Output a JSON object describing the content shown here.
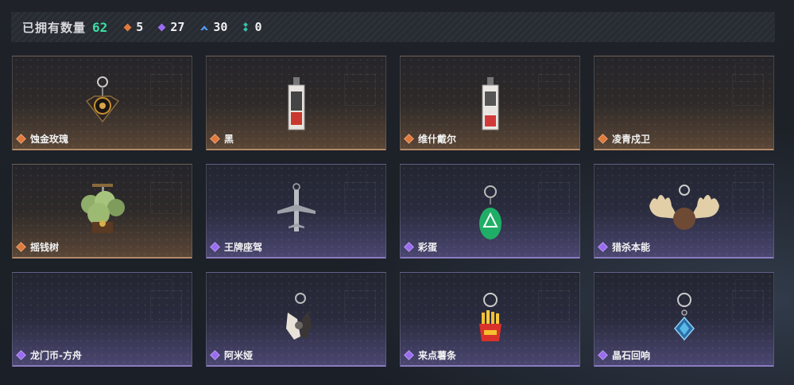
{
  "header": {
    "title": "已拥有数量",
    "count": "62",
    "stats": [
      {
        "icon": "orange-diamond-icon",
        "color": "#e07a3c",
        "value": "5"
      },
      {
        "icon": "purple-diamond-icon",
        "color": "#9a6cf0",
        "value": "27"
      },
      {
        "icon": "blue-chevron-icon",
        "color": "#4f9cf0",
        "value": "30"
      },
      {
        "icon": "teal-dots-icon",
        "color": "#32c4b0",
        "value": "0"
      }
    ]
  },
  "cards": [
    {
      "name": "蚀金玫瑰",
      "rarity": "orange",
      "item": "rose-charm"
    },
    {
      "name": "黑",
      "rarity": "orange",
      "item": "tag-charm"
    },
    {
      "name": "维什戴尔",
      "rarity": "orange",
      "item": "tag-charm-red"
    },
    {
      "name": "凌青戍卫",
      "rarity": "orange",
      "item": "none"
    },
    {
      "name": "摇钱树",
      "rarity": "orange",
      "item": "tree-charm"
    },
    {
      "name": "王牌座驾",
      "rarity": "purple",
      "item": "jet-charm"
    },
    {
      "name": "彩蛋",
      "rarity": "purple",
      "item": "egg-charm"
    },
    {
      "name": "猎杀本能",
      "rarity": "purple",
      "item": "antler-charm"
    },
    {
      "name": "龙门币-方舟",
      "rarity": "purple",
      "item": "none"
    },
    {
      "name": "阿米娅",
      "rarity": "purple",
      "item": "bunny-charm"
    },
    {
      "name": "来点薯条",
      "rarity": "purple",
      "item": "fries-charm"
    },
    {
      "name": "晶石回响",
      "rarity": "purple",
      "item": "crystal-charm"
    }
  ],
  "colors": {
    "orange": "#e07a3c",
    "purple": "#9a6cf0",
    "accent_count": "#39e0a3"
  }
}
